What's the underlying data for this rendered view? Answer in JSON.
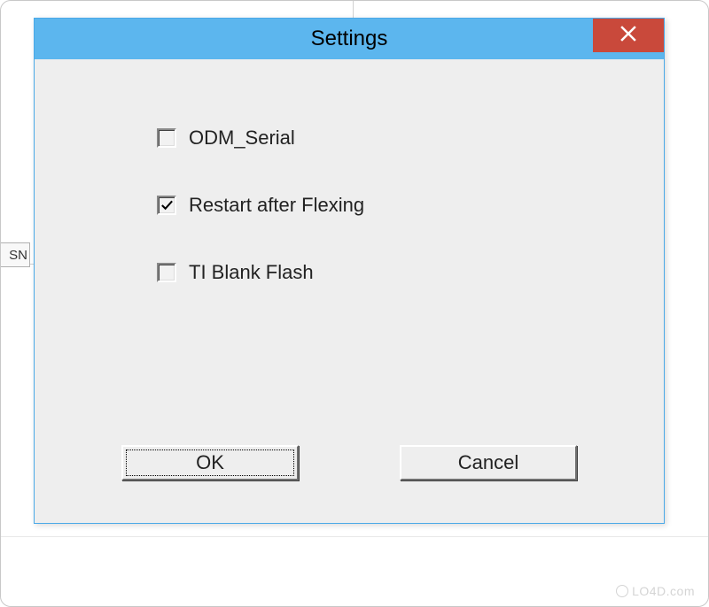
{
  "background": {
    "cell_label": "SN"
  },
  "dialog": {
    "title": "Settings",
    "options": [
      {
        "label": "ODM_Serial",
        "checked": false
      },
      {
        "label": "Restart after Flexing",
        "checked": true
      },
      {
        "label": "TI Blank Flash",
        "checked": false
      }
    ],
    "buttons": {
      "ok": "OK",
      "cancel": "Cancel"
    }
  },
  "watermark": "LO4D.com"
}
